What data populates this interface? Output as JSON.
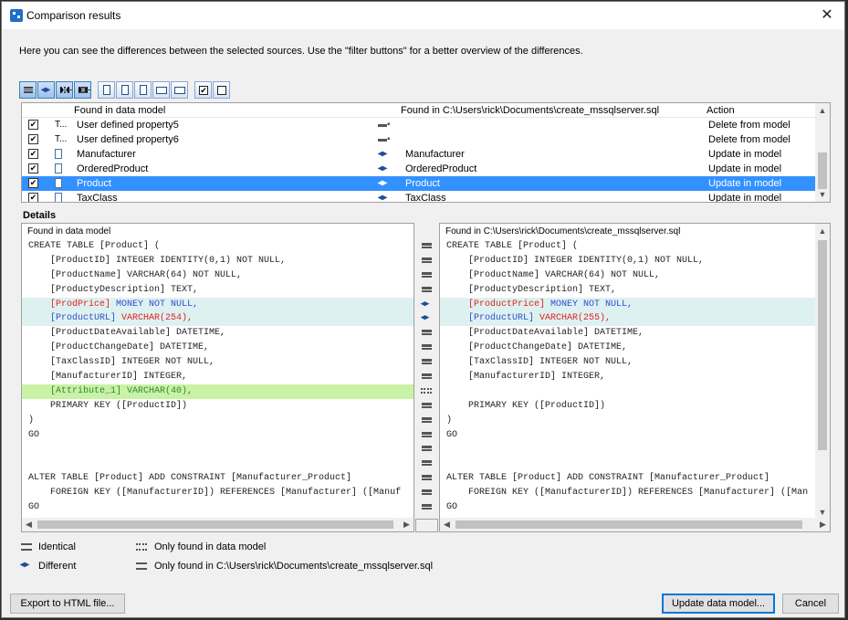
{
  "window": {
    "title": "Comparison results",
    "close_glyph": "✕"
  },
  "intro": "Here you can see the differences between the selected sources. Use the \"filter buttons\" for a better overview of the differences.",
  "toolbar": {
    "buttons": [
      "show-identical-icon",
      "show-different-icon",
      "show-only-model-icon",
      "show-only-file-icon",
      "table-icon",
      "relation-icon",
      "settings-icon",
      "property-icon",
      "field-icon",
      "check-all-icon",
      "uncheck-all-icon"
    ],
    "check_glyph": "✔"
  },
  "list": {
    "headers": {
      "model": "Found in data model",
      "file": "Found in C:\\Users\\rick\\Documents\\create_mssqlserver.sql",
      "action": "Action"
    },
    "rows": [
      {
        "checked": "✔",
        "type": "T...",
        "model": "User defined property5",
        "status": "only",
        "file": "",
        "action": "Delete from model"
      },
      {
        "checked": "✔",
        "type": "T...",
        "model": "User defined property6",
        "status": "only",
        "file": "",
        "action": "Delete from model"
      },
      {
        "checked": "✔",
        "type": "",
        "model": "Manufacturer",
        "status": "diff",
        "file": "Manufacturer",
        "action": "Update in model"
      },
      {
        "checked": "✔",
        "type": "",
        "model": "OrderedProduct",
        "status": "diff",
        "file": "OrderedProduct",
        "action": "Update in model"
      },
      {
        "checked": "✔",
        "type": "",
        "model": "Product",
        "status": "diff",
        "file": "Product",
        "action": "Update in model"
      },
      {
        "checked": "✔",
        "type": "",
        "model": "TaxClass",
        "status": "diff",
        "file": "TaxClass",
        "action": "Update in model"
      }
    ],
    "selected_row": 4
  },
  "details": {
    "label": "Details",
    "left_header": "Found in data model",
    "right_header": "Found in C:\\Users\\rick\\Documents\\create_mssqlserver.sql",
    "left_lines": [
      {
        "t": "CREATE TABLE [Product] (",
        "k": "n"
      },
      {
        "t": "    [ProductID] INTEGER IDENTITY(0,1) NOT NULL,",
        "k": "n"
      },
      {
        "t": "    [ProductName] VARCHAR(64) NOT NULL,",
        "k": "n"
      },
      {
        "t": "    [ProductyDescription] TEXT,",
        "k": "n"
      },
      {
        "t": "    [ProdPrice] MONEY NOT NULL,",
        "k": "d1"
      },
      {
        "t": "    [ProductURL] VARCHAR(254),",
        "k": "d2"
      },
      {
        "t": "    [ProductDateAvailable] DATETIME,",
        "k": "n"
      },
      {
        "t": "    [ProductChangeDate] DATETIME,",
        "k": "n"
      },
      {
        "t": "    [TaxClassID] INTEGER NOT NULL,",
        "k": "n"
      },
      {
        "t": "    [ManufacturerID] INTEGER,",
        "k": "n"
      },
      {
        "t": "    [Attribute_1] VARCHAR(40),",
        "k": "o"
      },
      {
        "t": "    PRIMARY KEY ([ProductID])",
        "k": "n"
      },
      {
        "t": ")",
        "k": "n"
      },
      {
        "t": "GO",
        "k": "n"
      },
      {
        "t": "",
        "k": "n"
      },
      {
        "t": "",
        "k": "n"
      },
      {
        "t": "ALTER TABLE [Product] ADD CONSTRAINT [Manufacturer_Product]",
        "k": "n"
      },
      {
        "t": "    FOREIGN KEY ([ManufacturerID]) REFERENCES [Manufacturer] ([Manuf",
        "k": "n"
      },
      {
        "t": "GO",
        "k": "n"
      }
    ],
    "right_lines": [
      {
        "t": "CREATE TABLE [Product] (",
        "k": "n"
      },
      {
        "t": "    [ProductID] INTEGER IDENTITY(0,1) NOT NULL,",
        "k": "n"
      },
      {
        "t": "    [ProductName] VARCHAR(64) NOT NULL,",
        "k": "n"
      },
      {
        "t": "    [ProductyDescription] TEXT,",
        "k": "n"
      },
      {
        "t": "    [ProductPrice] MONEY NOT NULL,",
        "k": "d1"
      },
      {
        "t": "    [ProductURL] VARCHAR(255),",
        "k": "d2"
      },
      {
        "t": "    [ProductDateAvailable] DATETIME,",
        "k": "n"
      },
      {
        "t": "    [ProductChangeDate] DATETIME,",
        "k": "n"
      },
      {
        "t": "    [TaxClassID] INTEGER NOT NULL,",
        "k": "n"
      },
      {
        "t": "    [ManufacturerID] INTEGER,",
        "k": "n"
      },
      {
        "t": "",
        "k": "n"
      },
      {
        "t": "    PRIMARY KEY ([ProductID])",
        "k": "n"
      },
      {
        "t": ")",
        "k": "n"
      },
      {
        "t": "GO",
        "k": "n"
      },
      {
        "t": "",
        "k": "n"
      },
      {
        "t": "",
        "k": "n"
      },
      {
        "t": "ALTER TABLE [Product] ADD CONSTRAINT [Manufacturer_Product]",
        "k": "n"
      },
      {
        "t": "    FOREIGN KEY ([ManufacturerID]) REFERENCES [Manufacturer] ([Man",
        "k": "n"
      },
      {
        "t": "GO",
        "k": "n"
      }
    ],
    "gutter": [
      "i",
      "i",
      "i",
      "i",
      "d",
      "d",
      "i",
      "i",
      "i",
      "i",
      "o",
      "i",
      "i",
      "i",
      "i",
      "i",
      "i",
      "i",
      "i"
    ]
  },
  "legend": {
    "identical": "Identical",
    "different": "Different",
    "only_model": "Only found in data model",
    "only_file": "Only found in C:\\Users\\rick\\Documents\\create_mssqlserver.sql"
  },
  "buttons": {
    "export": "Export to HTML file...",
    "update": "Update data model...",
    "cancel": "Cancel"
  },
  "colors": {
    "selection": "#3390ff",
    "diff_bg": "#def1f1",
    "only_bg": "#c9f2a6",
    "red": "#e02020",
    "blue": "#2b4fcf"
  }
}
